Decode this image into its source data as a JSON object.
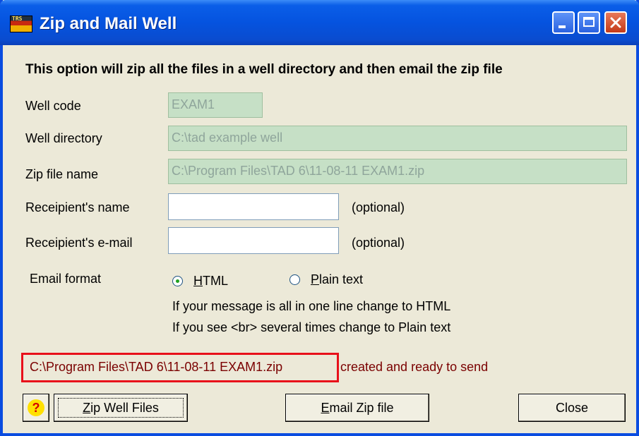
{
  "window": {
    "title": "Zip and Mail Well",
    "icon_label": "TRS"
  },
  "heading": "This option will zip all the files in a well directory and then email the zip file",
  "fields": {
    "well_code": {
      "label": "Well code",
      "value": "EXAM1"
    },
    "well_directory": {
      "label": "Well directory",
      "value": "C:\\tad example well"
    },
    "zip_file_name": {
      "label": "Zip file name",
      "value": "C:\\Program Files\\TAD 6\\11-08-11 EXAM1.zip"
    },
    "recipient_name": {
      "label": "Receipient's name",
      "value": "",
      "note": "(optional)"
    },
    "recipient_email": {
      "label": "Receipient's e-mail",
      "value": "",
      "note": "(optional)"
    }
  },
  "email_format": {
    "label": "Email format",
    "options": [
      "HTML",
      "Plain text"
    ],
    "selected": "HTML",
    "hint1": "If your message is all in one line change to HTML",
    "hint2": "If you see <br> several times change to Plain text"
  },
  "status": {
    "path": "C:\\Program Files\\TAD 6\\11-08-11 EXAM1.zip",
    "message": "created and ready to send",
    "color": "#7a0000",
    "highlight_color": "#e8101a"
  },
  "buttons": {
    "help": "?",
    "zip_well_files_first": "Z",
    "zip_well_files_rest": "ip Well Files",
    "email_zip_first": "E",
    "email_zip_rest": "mail Zip file",
    "close": "Close"
  }
}
